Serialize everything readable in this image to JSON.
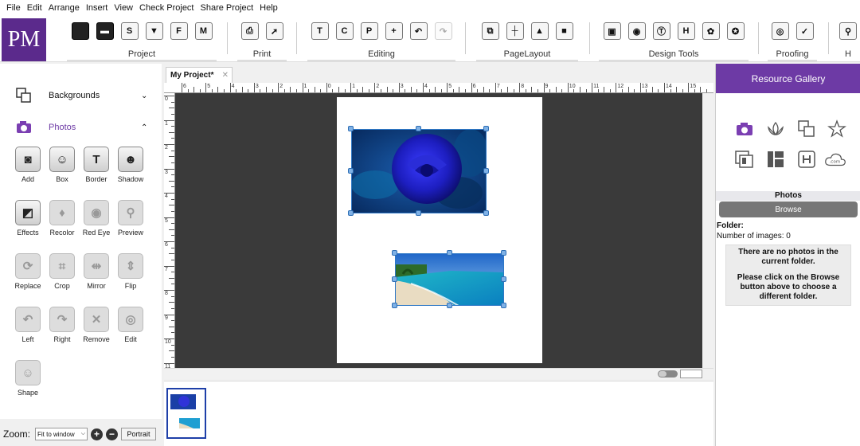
{
  "menu": [
    "File",
    "Edit",
    "Arrange",
    "Insert",
    "View",
    "Check Project",
    "Share Project",
    "Help"
  ],
  "logo": "PM",
  "ribbon": {
    "groups": {
      "project": "Project",
      "print": "Print",
      "editing": "Editing",
      "pagelayout": "PageLayout",
      "designtools": "Design Tools",
      "proofing": "Proofing",
      "help_partial": "H"
    }
  },
  "left": {
    "backgrounds": "Backgrounds",
    "photos": "Photos",
    "tools": {
      "add": "Add",
      "box": "Box",
      "border": "Border",
      "shadow": "Shadow",
      "effects": "Effects",
      "recolor": "Recolor",
      "redeye": "Red Eye",
      "preview": "Preview",
      "replace": "Replace",
      "crop": "Crop",
      "mirror": "Mirror",
      "flip": "Flip",
      "left": "Left",
      "right": "Right",
      "remove": "Remove",
      "edit": "Edit",
      "shape": "Shape"
    }
  },
  "zoom": {
    "label": "Zoom:",
    "value": "Fit to window",
    "plus": "+",
    "minus": "−",
    "orientation": "Portrait"
  },
  "tab": {
    "name": "My Project*",
    "close": "✕"
  },
  "ruler": {
    "h": [
      "6",
      "5",
      "4",
      "3",
      "2",
      "1",
      "0",
      "1",
      "2",
      "3",
      "4",
      "5",
      "6",
      "7",
      "8",
      "9",
      "10",
      "11",
      "12",
      "13",
      "14",
      "15"
    ],
    "v": [
      "0",
      "1",
      "2",
      "3",
      "4",
      "5",
      "6",
      "7",
      "8",
      "9",
      "10",
      "11"
    ]
  },
  "right": {
    "title": "Resource Gallery",
    "section": "Photos",
    "browse": "Browse",
    "folder": "Folder:",
    "count": "Number of images: 0",
    "msg1": "There are no photos in the current folder.",
    "msg2": "Please click on the Browse button above to choose a different folder."
  },
  "colors": {
    "brand": "#5b2a8c",
    "gallery": "#6d3aa5",
    "canvas": "#3a3a3a",
    "selection": "#2f78c6"
  }
}
